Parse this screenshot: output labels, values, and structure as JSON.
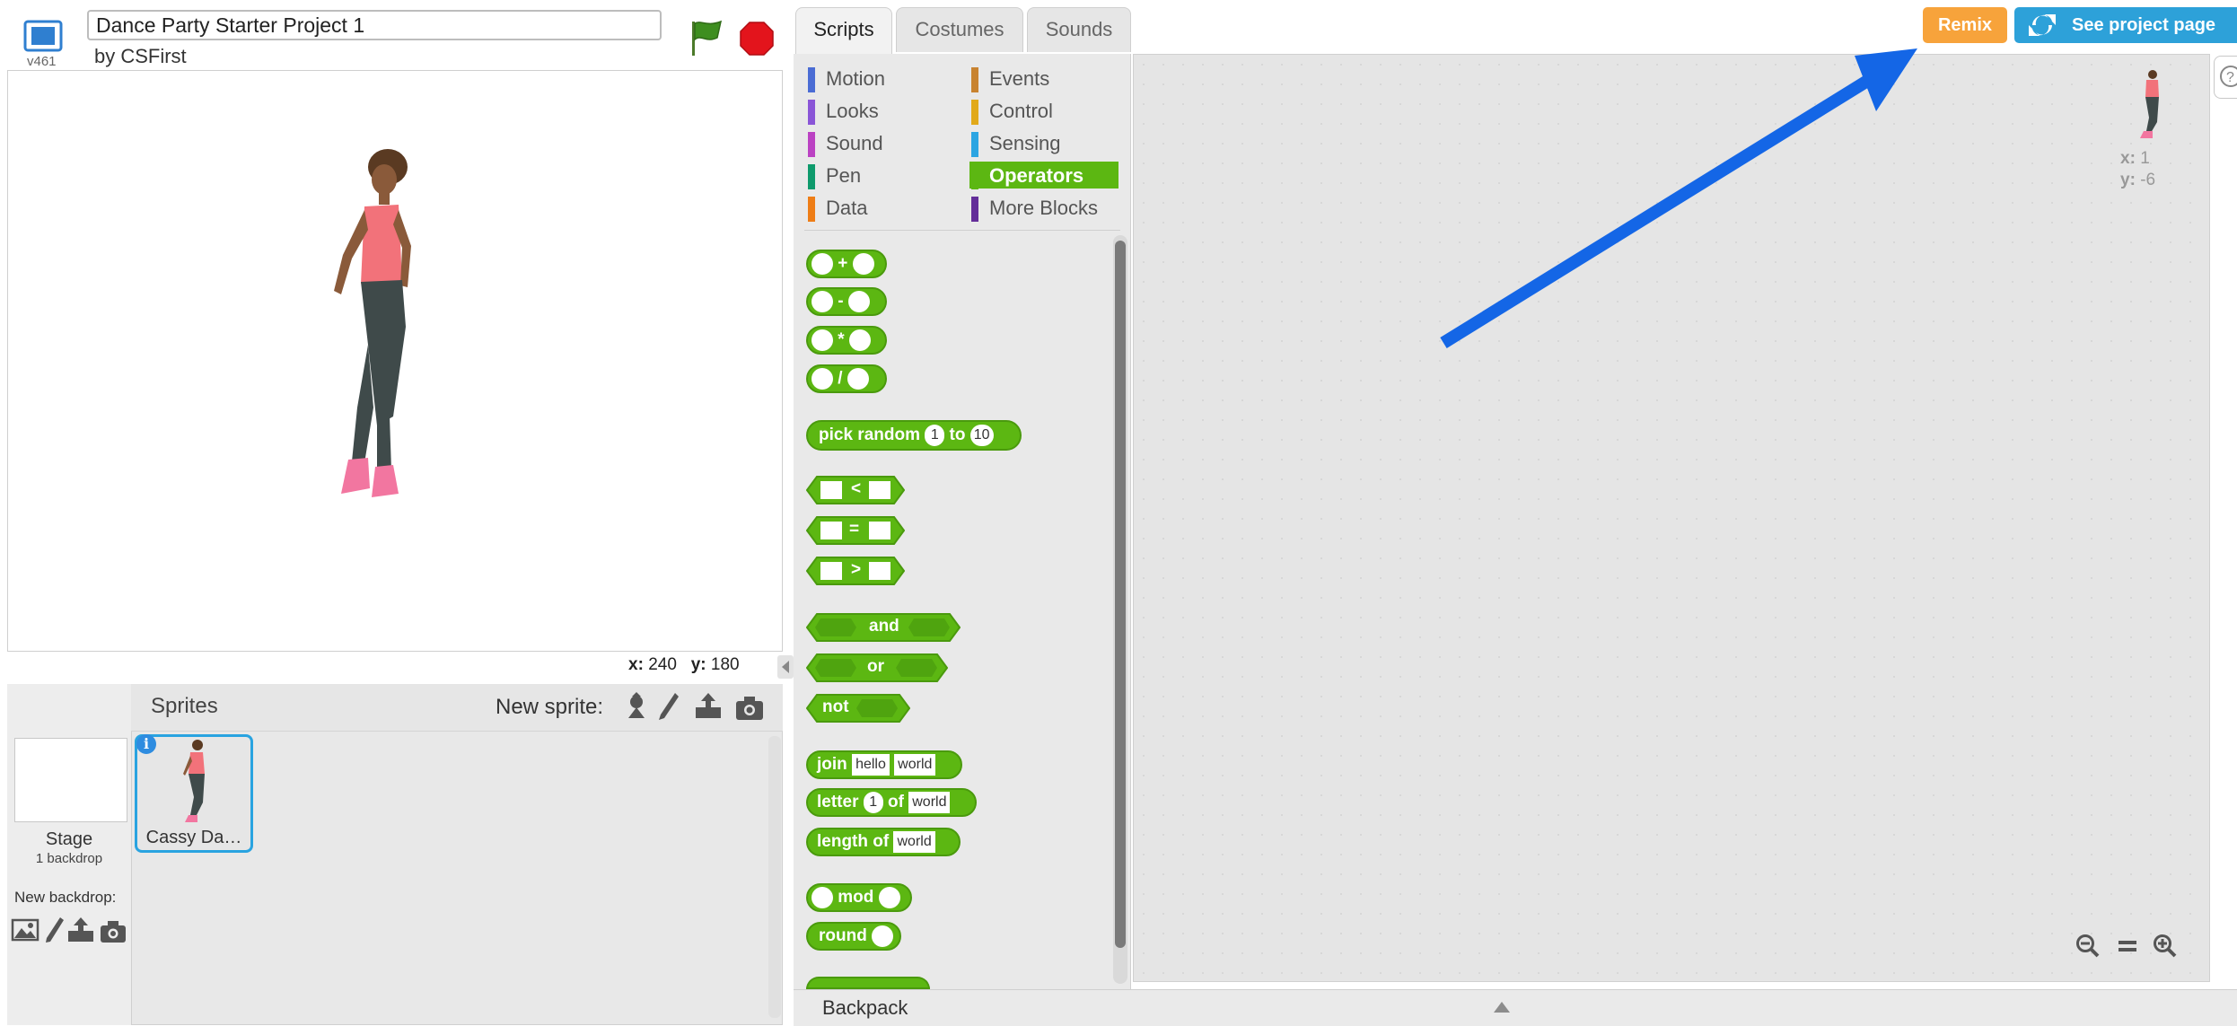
{
  "header": {
    "version": "v461",
    "project_title": "Dance Party Starter Project 1",
    "byline": "by CSFirst"
  },
  "stage": {
    "coords_x_label": "x:",
    "coords_x_value": "240",
    "coords_y_label": "y:",
    "coords_y_value": "180"
  },
  "sprites_pane": {
    "title": "Sprites",
    "new_sprite_label": "New sprite:",
    "stage_name": "Stage",
    "stage_backdrops": "1 backdrop",
    "new_backdrop_label": "New backdrop:",
    "sprite_info_glyph": "i",
    "sprites": [
      {
        "name": "Cassy Da…"
      }
    ]
  },
  "tabs": [
    "Scripts",
    "Costumes",
    "Sounds"
  ],
  "categories": {
    "left": [
      {
        "label": "Motion",
        "color": "#4a6cd4"
      },
      {
        "label": "Looks",
        "color": "#8a55d7"
      },
      {
        "label": "Sound",
        "color": "#bb42c3"
      },
      {
        "label": "Pen",
        "color": "#0e9a6c"
      },
      {
        "label": "Data",
        "color": "#ee7d16"
      }
    ],
    "right": [
      {
        "label": "Events",
        "color": "#c88330"
      },
      {
        "label": "Control",
        "color": "#e1a91a"
      },
      {
        "label": "Sensing",
        "color": "#2ca5e2"
      },
      {
        "label": "Operators",
        "color": "#5cb712"
      },
      {
        "label": "More Blocks",
        "color": "#632d99"
      }
    ]
  },
  "blocks": {
    "plus": "+",
    "minus": "-",
    "times": "*",
    "divide": "/",
    "pick_random": "pick random",
    "pick_random_from": "1",
    "pick_random_to_word": "to",
    "pick_random_to": "10",
    "lt": "<",
    "eq": "=",
    "gt": ">",
    "and": "and",
    "or": "or",
    "not": "not",
    "join": "join",
    "join_a": "hello",
    "join_b": "world",
    "letter": "letter",
    "letter_n": "1",
    "letter_of": "of",
    "letter_str": "world",
    "length_of": "length of",
    "length_str": "world",
    "mod": "mod",
    "round": "round"
  },
  "top_buttons": {
    "remix": "Remix",
    "see_project_page": "See project page"
  },
  "script_area": {
    "sprite_x_label": "x:",
    "sprite_x_value": "1",
    "sprite_y_label": "y:",
    "sprite_y_value": "-6"
  },
  "backpack": {
    "label": "Backpack"
  },
  "colors": {
    "operators": "#5cb712",
    "remix": "#f7a33b",
    "see_project": "#2da1d9",
    "annotation_arrow": "#1466e6",
    "selection": "#29a3e0"
  }
}
